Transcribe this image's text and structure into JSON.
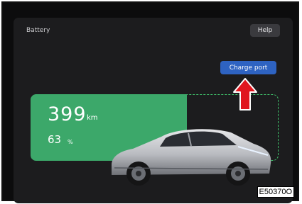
{
  "header": {
    "title": "Battery",
    "help_label": "Help"
  },
  "charge_port": {
    "label": "Charge port"
  },
  "battery": {
    "range_value": "399",
    "range_unit": "km",
    "percent_value": "63",
    "percent_unit": "%",
    "fill_fraction": 0.63,
    "fill_color": "#3ca86a",
    "outline_color": "#3fbf6a"
  },
  "callout": {
    "color": "#e0161e"
  },
  "figure_code": "E50370O",
  "icons": {
    "car": "car-illustration",
    "arrow": "arrow-up-icon"
  }
}
